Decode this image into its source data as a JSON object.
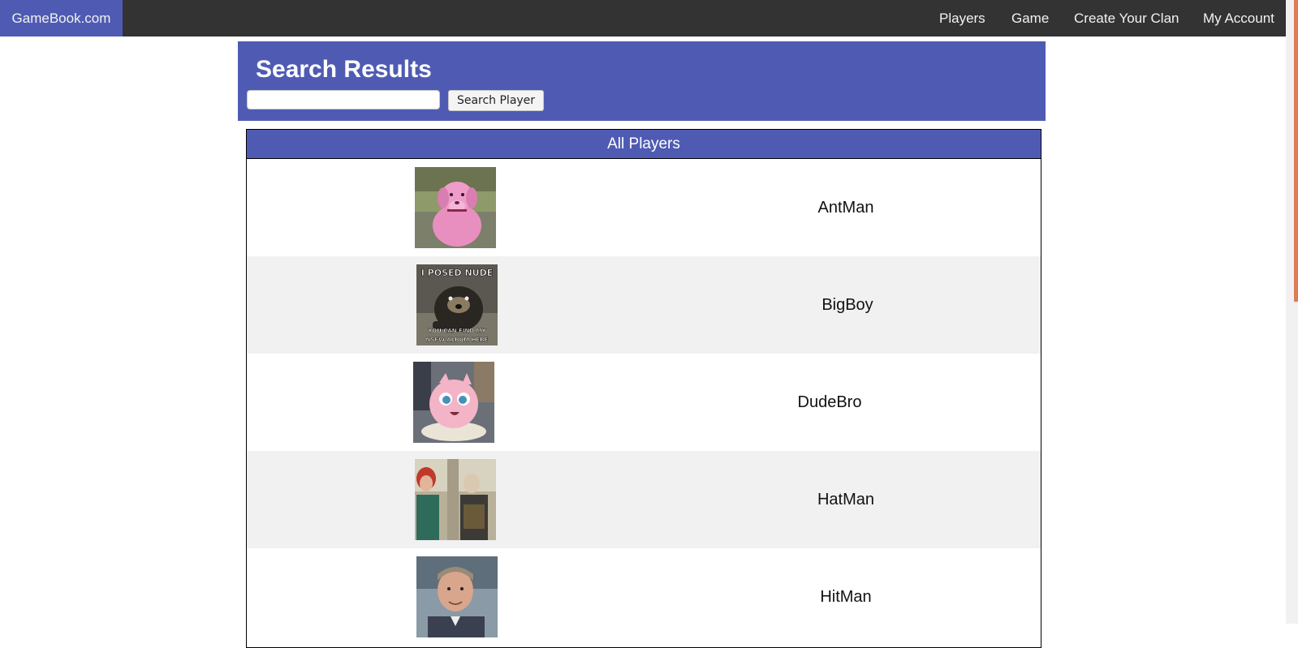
{
  "nav": {
    "brand": "GameBook.com",
    "links": [
      "Players",
      "Game",
      "Create Your Clan",
      "My Account"
    ]
  },
  "header": {
    "title": "Search Results",
    "search_placeholder": "",
    "search_button": "Search Player"
  },
  "table": {
    "title": "All Players",
    "players": [
      {
        "name": "AntMan"
      },
      {
        "name": "BigBoy",
        "avatar_caption_top": "I POSED NUDE",
        "avatar_caption_bottom": "YOU CAN FIND MY NSFW ALBUM HERE"
      },
      {
        "name": "DudeBro"
      },
      {
        "name": "HatMan"
      },
      {
        "name": "HitMan"
      }
    ]
  },
  "colors": {
    "accent": "#4f5bb3",
    "nav_bg": "#333333",
    "row_alt": "#f1f1f1"
  }
}
